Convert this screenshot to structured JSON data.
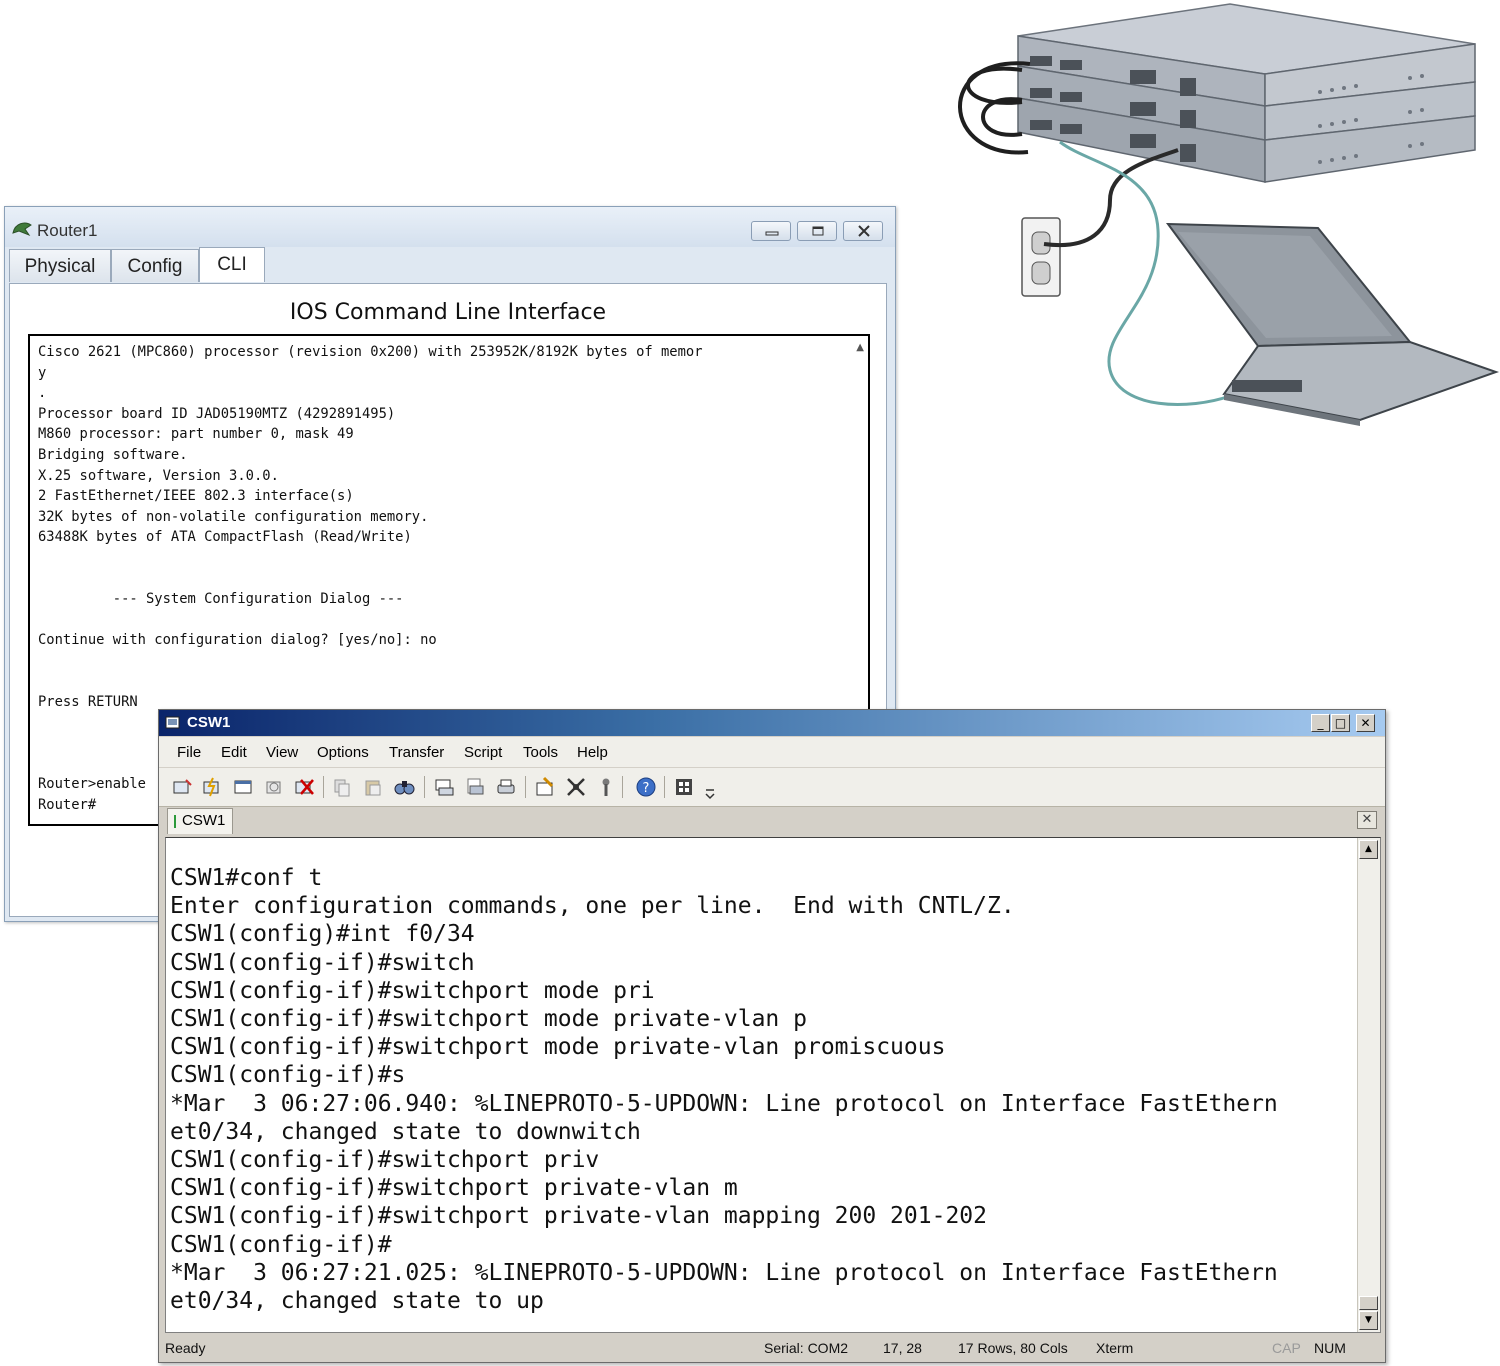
{
  "router_window": {
    "title": "Router1",
    "tabs": [
      {
        "label": "Physical"
      },
      {
        "label": "Config"
      },
      {
        "label": "CLI"
      }
    ],
    "active_tab": "CLI",
    "heading": "IOS Command Line Interface",
    "console_lines": [
      "Cisco 2621 (MPC860) processor (revision 0x200) with 253952K/8192K bytes of memor",
      "y",
      ".",
      "Processor board ID JAD05190MTZ (4292891495)",
      "M860 processor: part number 0, mask 49",
      "Bridging software.",
      "X.25 software, Version 3.0.0.",
      "2 FastEthernet/IEEE 802.3 interface(s)",
      "32K bytes of non-volatile configuration memory.",
      "63488K bytes of ATA CompactFlash (Read/Write)",
      "",
      "",
      "         --- System Configuration Dialog ---",
      "",
      "Continue with configuration dialog? [yes/no]: no",
      "",
      "",
      "Press RETURN",
      "",
      "",
      "",
      "Router>enable",
      "Router#"
    ]
  },
  "csw_window": {
    "title": "CSW1",
    "menu": [
      {
        "label": "File"
      },
      {
        "label": "Edit"
      },
      {
        "label": "View"
      },
      {
        "label": "Options"
      },
      {
        "label": "Transfer"
      },
      {
        "label": "Script"
      },
      {
        "label": "Tools"
      },
      {
        "label": "Help"
      }
    ],
    "toolbar_icons": [
      "connect-icon",
      "quick-connect-icon",
      "connect-tab-icon",
      "reconnect-icon",
      "disconnect-icon",
      "copy-icon",
      "paste-icon",
      "find-icon",
      "print-setup-icon",
      "print-icon",
      "print-screen-icon",
      "session-options-icon",
      "keymap-icon",
      "sftp-icon",
      "help-icon",
      "keypad-icon",
      "toolbar-overflow-icon"
    ],
    "session_tab": "CSW1",
    "terminal_lines": [
      "CSW1#conf t",
      "Enter configuration commands, one per line.  End with CNTL/Z.",
      "CSW1(config)#int f0/34",
      "CSW1(config-if)#switch",
      "CSW1(config-if)#switchport mode pri",
      "CSW1(config-if)#switchport mode private-vlan p",
      "CSW1(config-if)#switchport mode private-vlan promiscuous",
      "CSW1(config-if)#s",
      "*Mar  3 06:27:06.940: %LINEPROTO-5-UPDOWN: Line protocol on Interface FastEthern",
      "et0/34, changed state to downwitch",
      "CSW1(config-if)#switchport priv",
      "CSW1(config-if)#switchport private-vlan m",
      "CSW1(config-if)#switchport private-vlan mapping 200 201-202",
      "CSW1(config-if)#",
      "*Mar  3 06:27:21.025: %LINEPROTO-5-UPDOWN: Line protocol on Interface FastEthern",
      "et0/34, changed state to up"
    ],
    "status": {
      "ready": "Ready",
      "serial": "Serial: COM2",
      "cursor": "17,  28",
      "size": "17 Rows,  80 Cols",
      "emulation": "Xterm",
      "caps": "CAP",
      "num": "NUM"
    }
  },
  "colors": {
    "xp_title_start": "#0a246a",
    "xp_title_end": "#a6caf0",
    "console_cable": "#6aa7a6"
  }
}
